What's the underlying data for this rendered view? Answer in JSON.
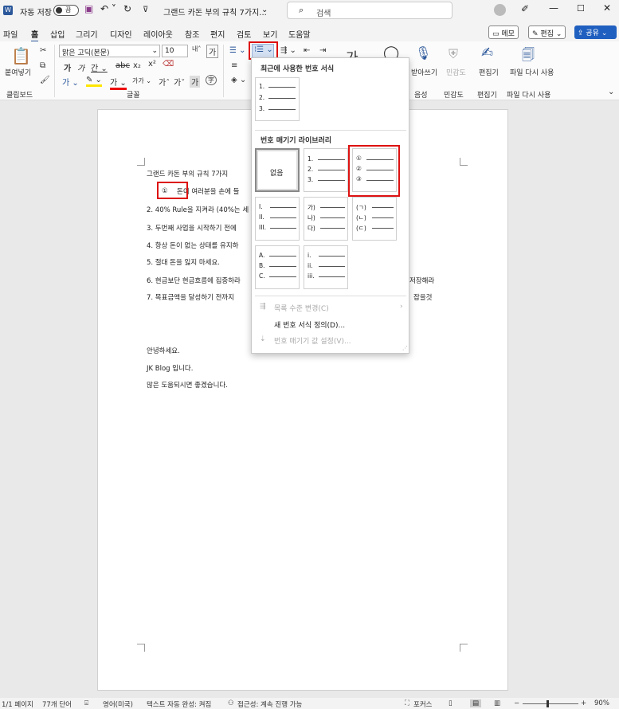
{
  "titlebar": {
    "autosave_label": "자동 저장",
    "autosave_state": "끔",
    "doc_title": "그랜드 카돈 부의 규칙 7가지...",
    "search_placeholder": "검색"
  },
  "menu": {
    "items": [
      "파일",
      "홈",
      "삽입",
      "그리기",
      "디자인",
      "레이아웃",
      "참조",
      "편지",
      "검토",
      "보기",
      "도움말"
    ],
    "memo": "메모",
    "edit": "편집",
    "share": "공유"
  },
  "ribbon": {
    "paste": "붙여넣기",
    "font_name": "맑은 고딕(본문)",
    "font_size": "10",
    "groups": {
      "clipboard": "클립보드",
      "font": "글꼴",
      "voice": "음성",
      "sensitivity": "민감도",
      "editor": "편집기",
      "reuse": "파일 다시 사용"
    },
    "dictate": "받아쓰기",
    "sensitivity_btn": "민감도",
    "editor_btn": "편집기",
    "reuse_btn": "파일 다시 사용"
  },
  "dropdown": {
    "recent_header": "최근에 사용한 번호 서식",
    "library_header": "번호 매기기 라이브러리",
    "none_label": "없음",
    "recent_lines": [
      "1.",
      "2.",
      "3."
    ],
    "tiles": [
      [
        "1.",
        "2.",
        "3."
      ],
      [
        "①",
        "②",
        "③"
      ],
      [
        "I.",
        "II.",
        "III."
      ],
      [
        "가)",
        "나)",
        "다)"
      ],
      [
        "(ㄱ)",
        "(ㄴ)",
        "(ㄷ)"
      ],
      [
        "A.",
        "B.",
        "C."
      ],
      [
        "i.",
        "ii.",
        "iii."
      ]
    ],
    "change_level": "목록 수준 변경(C)",
    "define_new": "새 번호 서식 정의(D)...",
    "set_value": "번호 매기기 값 설정(V)..."
  },
  "document": {
    "title": "그랜드 카돈 부의 규칙 7가지",
    "item1_marker": "①",
    "item1": "돈이 여러분을 손에 들",
    "item2": "2. 40% Rule을 지켜라 (40%는 세",
    "item3": "3. 두번째 사업을 시작하기 전에",
    "item4": "4. 항상 돈이 없는 상태를 유지하",
    "item5": "5. 절대 돈을 잃지 마세요.",
    "item6": "6. 현금보단 현금흐름에 집중하라",
    "item6_tail": "저장해라",
    "item7": "7. 목표금액을 달성하기 전까지 ",
    "item7_tail": "잡을것",
    "hello": "안녕하세요.",
    "blog": "JK Blog 입니다.",
    "hope": "많은 도움되시면 좋겠습니다."
  },
  "status": {
    "page": "1/1 페이지",
    "words": "77개 단어",
    "lang": "영어(미국)",
    "autocomplete": "텍스트 자동 완성: 켜짐",
    "accessibility": "접근성: 계속 진행 가능",
    "focus": "포커스",
    "zoom": "90%"
  }
}
